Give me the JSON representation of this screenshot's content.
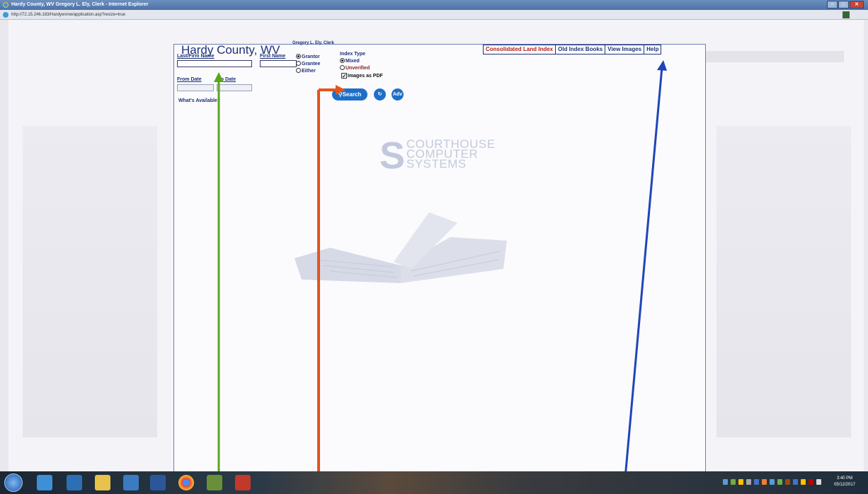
{
  "window": {
    "title": "Hardy County, WV  Gregory L. Ely, Clerk   - Internet Explorer",
    "address": "http://72.15.246.183/Hardywvnw/application.asp?resize=true"
  },
  "app": {
    "county": "Hardy County, WV",
    "clerk": "Gregory L. Ely, Clerk",
    "tabs": [
      {
        "label": "Consolidated Land Index",
        "active": true
      },
      {
        "label": "Old Index Books",
        "active": false
      },
      {
        "label": "View Images",
        "active": false
      },
      {
        "label": "Help",
        "active": false
      }
    ],
    "form": {
      "last_name_label": "Last/Firm Name",
      "first_name_label": "First Name",
      "party_options": [
        {
          "label": "Grantor",
          "checked": true
        },
        {
          "label": "Grantee",
          "checked": false
        },
        {
          "label": "Either",
          "checked": false
        }
      ],
      "index_type_label": "Index Type",
      "index_options": [
        {
          "label": "Mixed",
          "checked": true
        },
        {
          "label": "Unverified",
          "checked": false
        }
      ],
      "images_pdf_label": "Images as PDF",
      "images_pdf_checked": true,
      "from_date_label": "From Date",
      "to_date_label": "To Date",
      "search_label": "Search",
      "adv_label": "Adv",
      "whats_available": "What's Available?"
    },
    "logo": {
      "mark": "S",
      "line1": "COURTHOUSE",
      "line2": "COMPUTER",
      "line3": "SYSTEMS"
    }
  },
  "taskbar": {
    "time": "3:40 PM",
    "date": "05/12/2017"
  },
  "colors": {
    "annotation_green": "#5aa51e",
    "annotation_orange": "#e2561c",
    "annotation_blue": "#1f45b8",
    "brand_navy": "#1d3278",
    "active_tab_red": "#b01c1c"
  }
}
